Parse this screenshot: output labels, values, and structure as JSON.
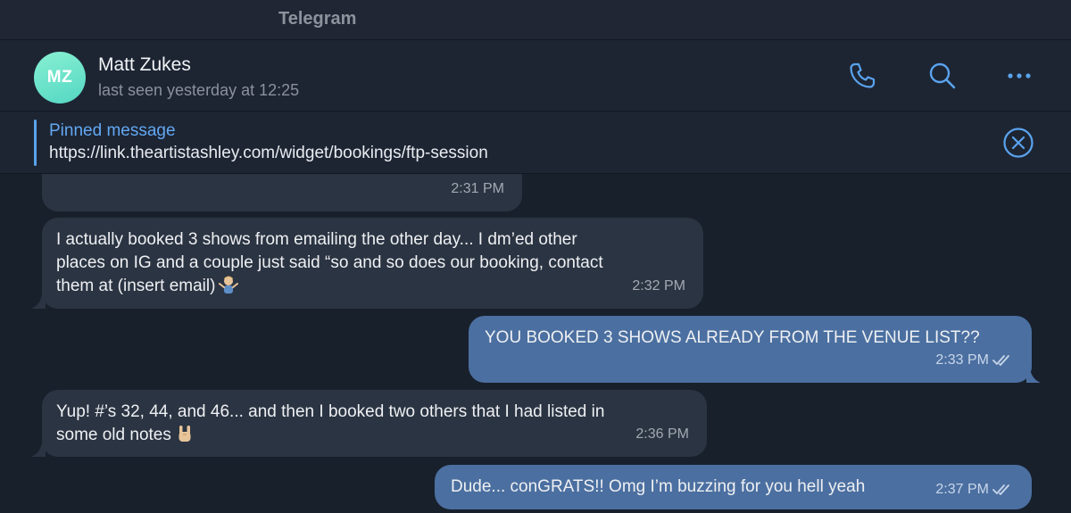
{
  "window": {
    "title": "Telegram"
  },
  "header": {
    "avatar_initials": "MZ",
    "contact_name": "Matt Zukes",
    "status": "last seen yesterday at 12:25",
    "icons": [
      "phone-icon",
      "search-icon",
      "more-icon"
    ]
  },
  "pinned": {
    "label": "Pinned message",
    "text": "https://link.theartistashley.com/widget/bookings/ftp-session",
    "close_icon": "close-circle-icon"
  },
  "messages": [
    {
      "direction": "in",
      "text": "",
      "time": "2:31 PM"
    },
    {
      "direction": "in",
      "lines": [
        "I actually booked 3 shows from emailing the other day... I dm’ed other",
        "places on IG and a couple just said “so and so does our booking, contact",
        "them at (insert email)"
      ],
      "emoji": "person-shrugging-emoji",
      "time": "2:32 PM"
    },
    {
      "direction": "out",
      "text": "YOU BOOKED 3 SHOWS ALREADY FROM THE VENUE LIST??",
      "time": "2:33 PM",
      "read": true
    },
    {
      "direction": "in",
      "lines": [
        "Yup! #’s 32, 44, and 46... and then I booked two others that I had listed in",
        "some old notes"
      ],
      "emoji": "rock-on-hand-emoji",
      "time": "2:36 PM"
    },
    {
      "direction": "out",
      "text": "Dude... conGRATS!! Omg I’m buzzing for you hell yeah",
      "time": "2:37 PM",
      "read": true
    }
  ],
  "colors": {
    "accent": "#5aa3ee",
    "incoming_bubble": "#2b3442",
    "outgoing_bubble": "#4b6fa0",
    "background": "#18202c",
    "avatar": "#6ee0cb"
  }
}
